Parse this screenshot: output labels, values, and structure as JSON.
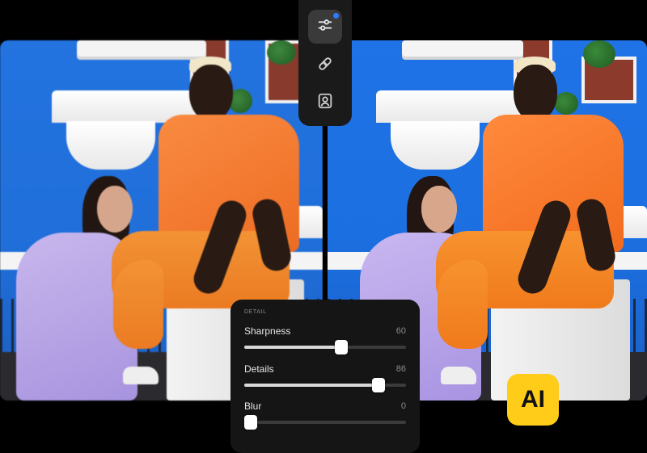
{
  "toolbar": {
    "tools": [
      {
        "icon": "sliders-icon",
        "active": true,
        "has_indicator": true
      },
      {
        "icon": "bandage-icon",
        "active": false
      },
      {
        "icon": "portrait-icon",
        "active": false
      }
    ]
  },
  "detail_panel": {
    "title": "DETAIL",
    "sliders": [
      {
        "label": "Sharpness",
        "value": "60",
        "level": 0.6
      },
      {
        "label": "Details",
        "value": "86",
        "level": 0.83
      },
      {
        "label": "Blur",
        "value": "0",
        "level": 0.04
      }
    ]
  },
  "badge": {
    "label": "AI",
    "color": "#ffcc1a"
  },
  "colors": {
    "wall_blue": "#1f73e6",
    "shirt_orange": "#f26b1d",
    "accent_dot": "#2e7bff"
  }
}
